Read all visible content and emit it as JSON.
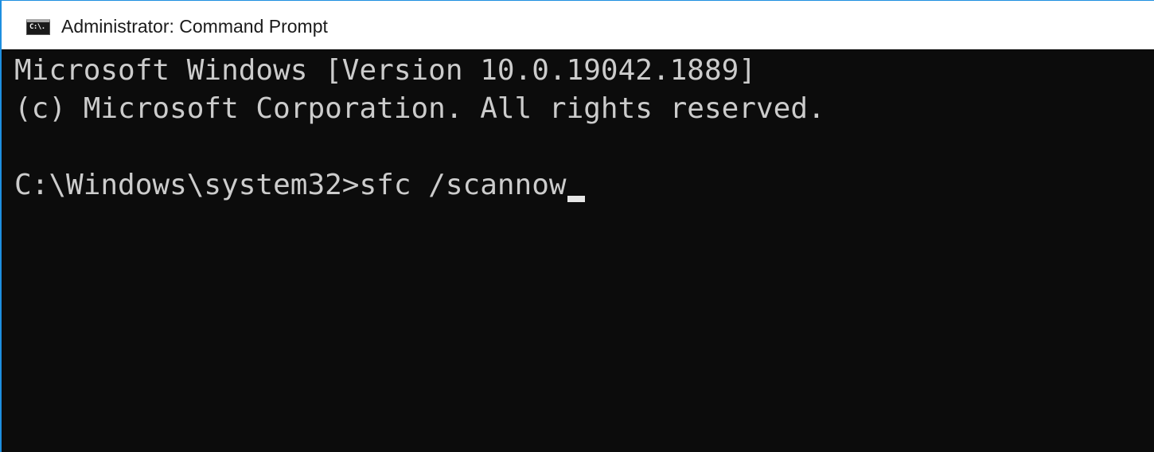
{
  "window": {
    "title": "Administrator: Command Prompt",
    "icon": "cmd-icon",
    "icon_glyph": "C:\\."
  },
  "console": {
    "lines": [
      "Microsoft Windows [Version 10.0.19042.1889]",
      "(c) Microsoft Corporation. All rights reserved.",
      ""
    ],
    "prompt": "C:\\Windows\\system32>",
    "command": "sfc /scannow"
  },
  "colors": {
    "console_background": "#0c0c0c",
    "console_text": "#cccccc",
    "title_bar": "#ffffff",
    "window_accent_border": "#1e8fe0"
  }
}
